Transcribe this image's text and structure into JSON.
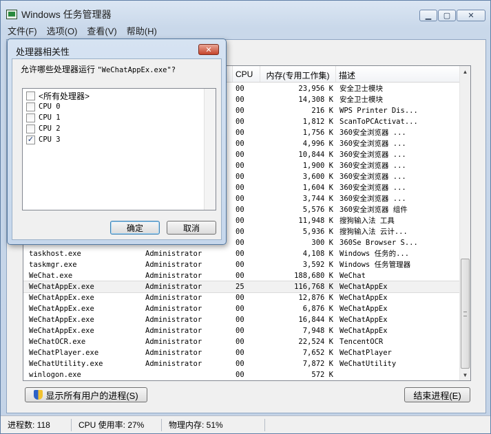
{
  "window": {
    "title": "Windows 任务管理器",
    "minimize": "▁",
    "maximize": "▢",
    "close": "✕"
  },
  "menu": [
    "文件(F)",
    "选项(O)",
    "查看(V)",
    "帮助(H)"
  ],
  "columns": [
    "CPU",
    "内存(专用工作集)",
    "描述"
  ],
  "rows": [
    {
      "name": "",
      "user": "",
      "cpu": "00",
      "mem": "23,956 K",
      "desc": "安全卫士模块"
    },
    {
      "name": "",
      "user": "",
      "cpu": "00",
      "mem": "14,308 K",
      "desc": "安全卫士模块"
    },
    {
      "name": "",
      "user": "",
      "cpu": "00",
      "mem": "216 K",
      "desc": "WPS Printer Dis..."
    },
    {
      "name": "",
      "user": "",
      "cpu": "00",
      "mem": "1,812 K",
      "desc": "ScanToPCActivat..."
    },
    {
      "name": "",
      "user": "",
      "cpu": "00",
      "mem": "1,756 K",
      "desc": "360安全浏览器 ..."
    },
    {
      "name": "",
      "user": "",
      "cpu": "00",
      "mem": "4,996 K",
      "desc": "360安全浏览器 ..."
    },
    {
      "name": "",
      "user": "",
      "cpu": "00",
      "mem": "10,844 K",
      "desc": "360安全浏览器 ..."
    },
    {
      "name": "",
      "user": "",
      "cpu": "00",
      "mem": "1,900 K",
      "desc": "360安全浏览器 ..."
    },
    {
      "name": "",
      "user": "",
      "cpu": "00",
      "mem": "3,600 K",
      "desc": "360安全浏览器 ..."
    },
    {
      "name": "",
      "user": "",
      "cpu": "00",
      "mem": "1,604 K",
      "desc": "360安全浏览器 ..."
    },
    {
      "name": "",
      "user": "",
      "cpu": "00",
      "mem": "3,744 K",
      "desc": "360安全浏览器 ..."
    },
    {
      "name": "",
      "user": "",
      "cpu": "00",
      "mem": "5,576 K",
      "desc": "360安全浏览器 组件"
    },
    {
      "name": "",
      "user": "",
      "cpu": "00",
      "mem": "11,948 K",
      "desc": "搜狗输入法 工具"
    },
    {
      "name": "",
      "user": "",
      "cpu": "00",
      "mem": "5,936 K",
      "desc": "搜狗输入法 云计..."
    },
    {
      "name": "",
      "user": "",
      "cpu": "00",
      "mem": "300 K",
      "desc": "360Se Browser S..."
    },
    {
      "name": "taskhost.exe",
      "user": "Administrator",
      "cpu": "00",
      "mem": "4,108 K",
      "desc": "Windows 任务的..."
    },
    {
      "name": "taskmgr.exe",
      "user": "Administrator",
      "cpu": "00",
      "mem": "3,592 K",
      "desc": "Windows 任务管理器"
    },
    {
      "name": "WeChat.exe",
      "user": "Administrator",
      "cpu": "00",
      "mem": "188,680 K",
      "desc": "WeChat"
    },
    {
      "name": "WeChatAppEx.exe",
      "user": "Administrator",
      "cpu": "25",
      "mem": "116,768 K",
      "desc": "WeChatAppEx",
      "selected": true
    },
    {
      "name": "WeChatAppEx.exe",
      "user": "Administrator",
      "cpu": "00",
      "mem": "12,876 K",
      "desc": "WeChatAppEx"
    },
    {
      "name": "WeChatAppEx.exe",
      "user": "Administrator",
      "cpu": "00",
      "mem": "6,876 K",
      "desc": "WeChatAppEx"
    },
    {
      "name": "WeChatAppEx.exe",
      "user": "Administrator",
      "cpu": "00",
      "mem": "16,844 K",
      "desc": "WeChatAppEx"
    },
    {
      "name": "WeChatAppEx.exe",
      "user": "Administrator",
      "cpu": "00",
      "mem": "7,948 K",
      "desc": "WeChatAppEx"
    },
    {
      "name": "WeChatOCR.exe",
      "user": "Administrator",
      "cpu": "00",
      "mem": "22,524 K",
      "desc": "TencentOCR"
    },
    {
      "name": "WeChatPlayer.exe",
      "user": "Administrator",
      "cpu": "00",
      "mem": "7,652 K",
      "desc": "WeChatPlayer"
    },
    {
      "name": "WeChatUtility.exe",
      "user": "Administrator",
      "cpu": "00",
      "mem": "7,872 K",
      "desc": "WeChatUtility"
    },
    {
      "name": "winlogon.exe",
      "user": "",
      "cpu": "00",
      "mem": "572 K",
      "desc": ""
    }
  ],
  "buttons": {
    "show_all": "显示所有用户的进程(S)",
    "end_process": "结束进程(E)"
  },
  "status": {
    "processes": "进程数: 118",
    "cpu": "CPU 使用率: 27%",
    "memory": "物理内存: 51%"
  },
  "dialog": {
    "title": "处理器相关性",
    "close": "✕",
    "prompt_prefix": "允许哪些处理器运行 ",
    "prompt_proc": "\"WeChatAppEx.exe\"?",
    "options": [
      {
        "label": "<所有处理器>",
        "checked": false
      },
      {
        "label": "CPU 0",
        "checked": false
      },
      {
        "label": "CPU 1",
        "checked": false
      },
      {
        "label": "CPU 2",
        "checked": false
      },
      {
        "label": "CPU 3",
        "checked": true
      }
    ],
    "ok": "确定",
    "cancel": "取消"
  },
  "icons": {
    "check": "✓",
    "scroll_up": "▲",
    "scroll_down": "▼"
  }
}
